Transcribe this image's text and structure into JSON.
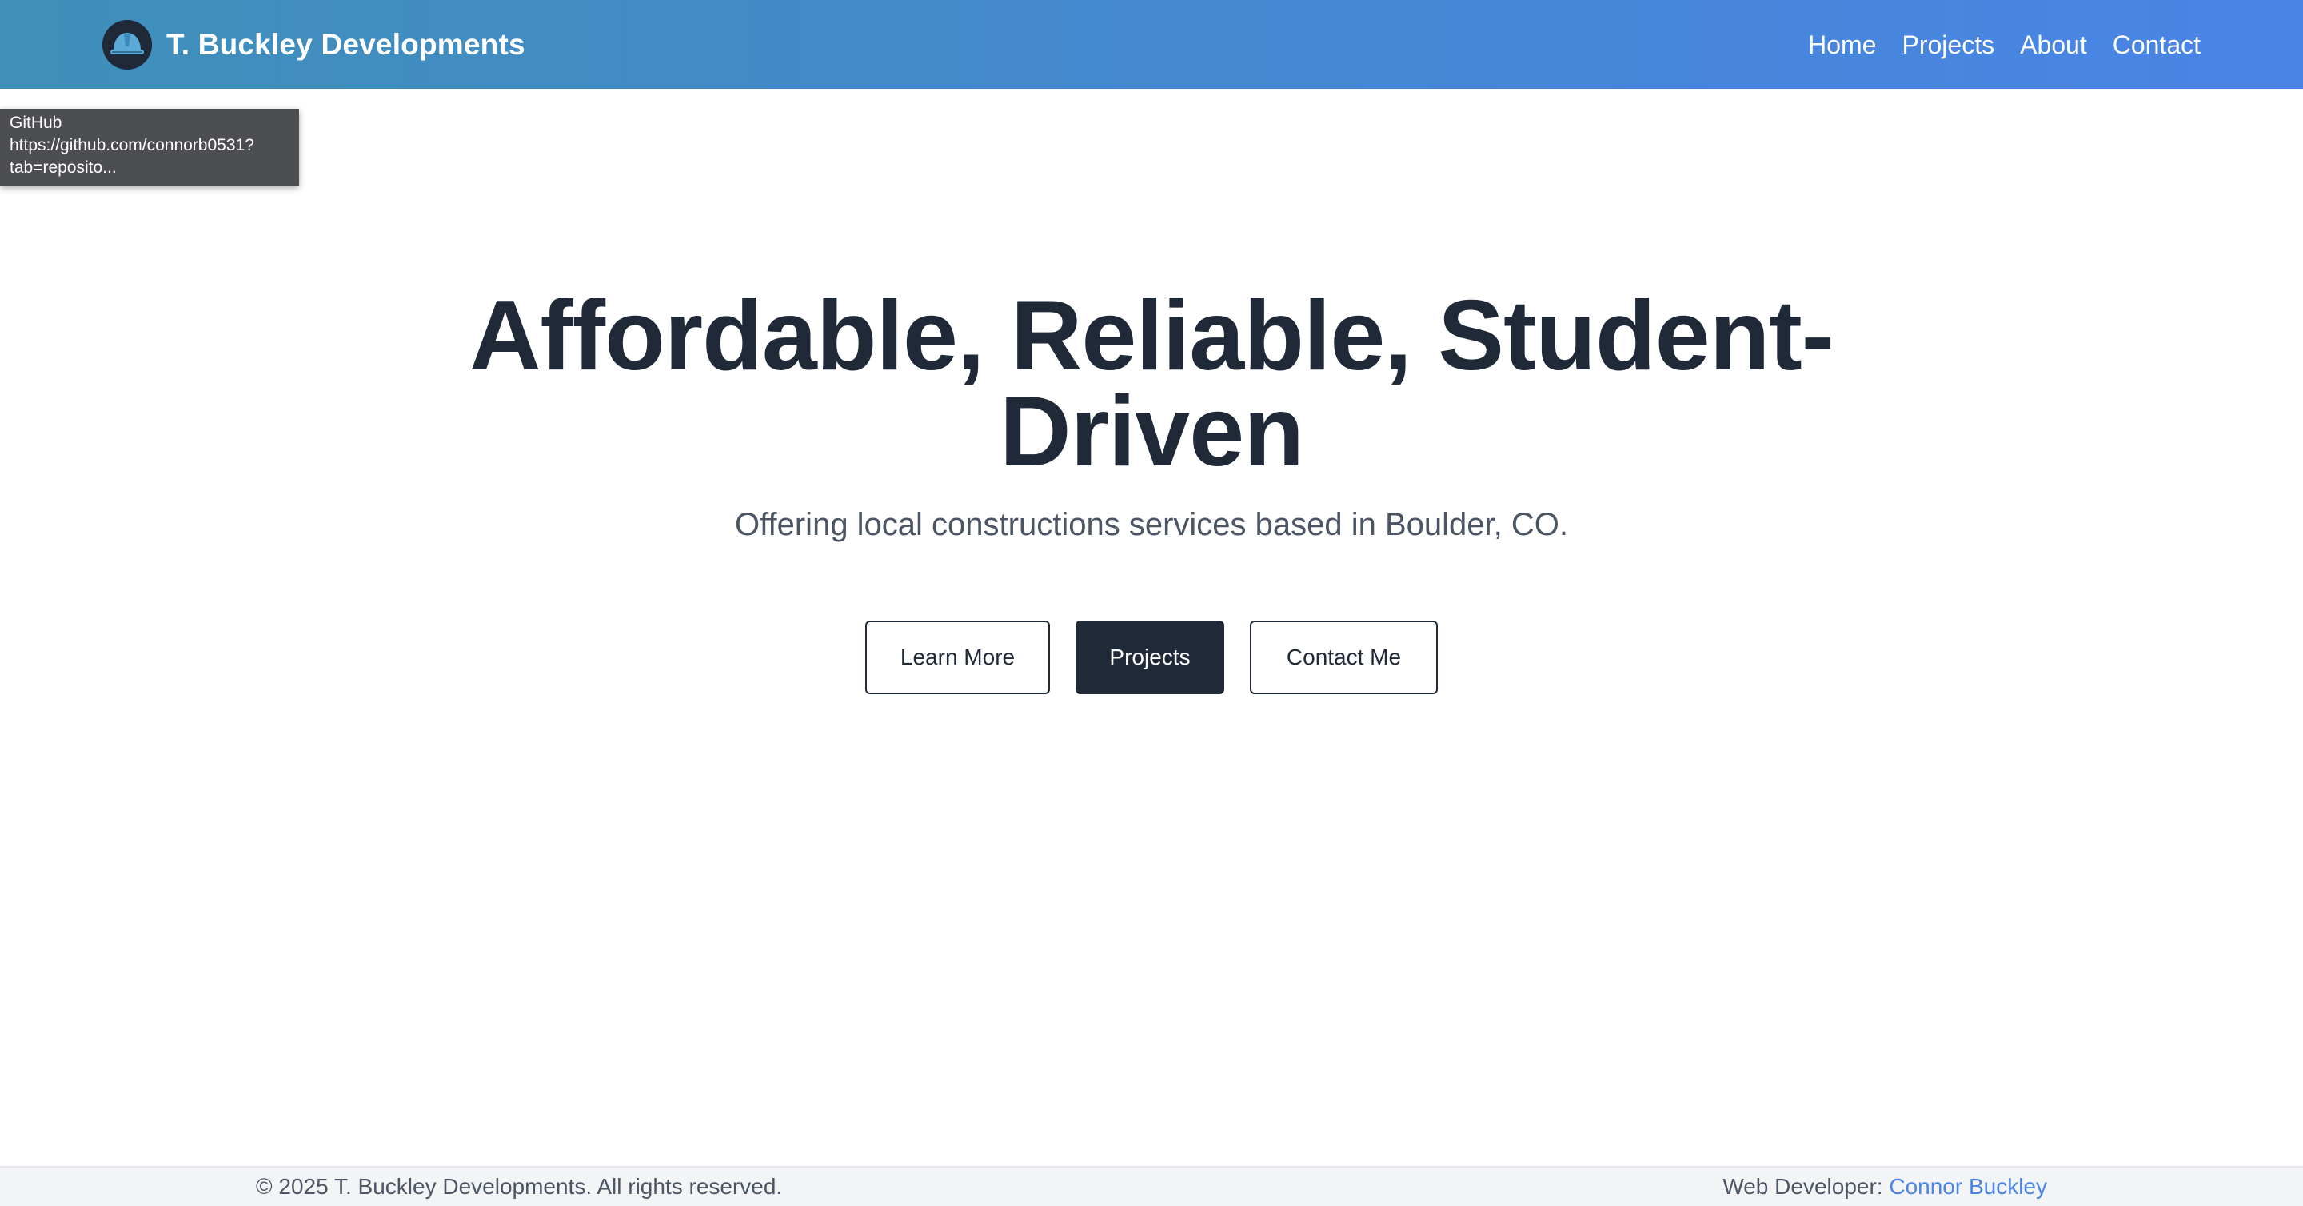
{
  "header": {
    "brand_name": "T. Buckley Developments",
    "logo_icon": "hard-hat-icon",
    "nav": [
      {
        "label": "Home"
      },
      {
        "label": "Projects"
      },
      {
        "label": "About"
      },
      {
        "label": "Contact"
      }
    ],
    "colors": {
      "gradient_start": "#3f8fb8",
      "gradient_end": "#4a84e6"
    }
  },
  "tooltip": {
    "title": "GitHub",
    "line1": "https://github.com/connorb0531?",
    "line2": "tab=reposito..."
  },
  "hero": {
    "title_line1": "Affordable, Reliable, Student-",
    "title_line2": "Driven",
    "subtitle": "Offering local constructions services based in Boulder, CO.",
    "buttons": {
      "learn_more": "Learn More",
      "projects": "Projects",
      "contact_me": "Contact Me"
    }
  },
  "footer": {
    "copyright": "© 2025 T. Buckley Developments. All rights reserved.",
    "developer_prefix": "Web Developer: ",
    "developer_name": "Connor Buckley",
    "link_color": "#4a84e6"
  }
}
